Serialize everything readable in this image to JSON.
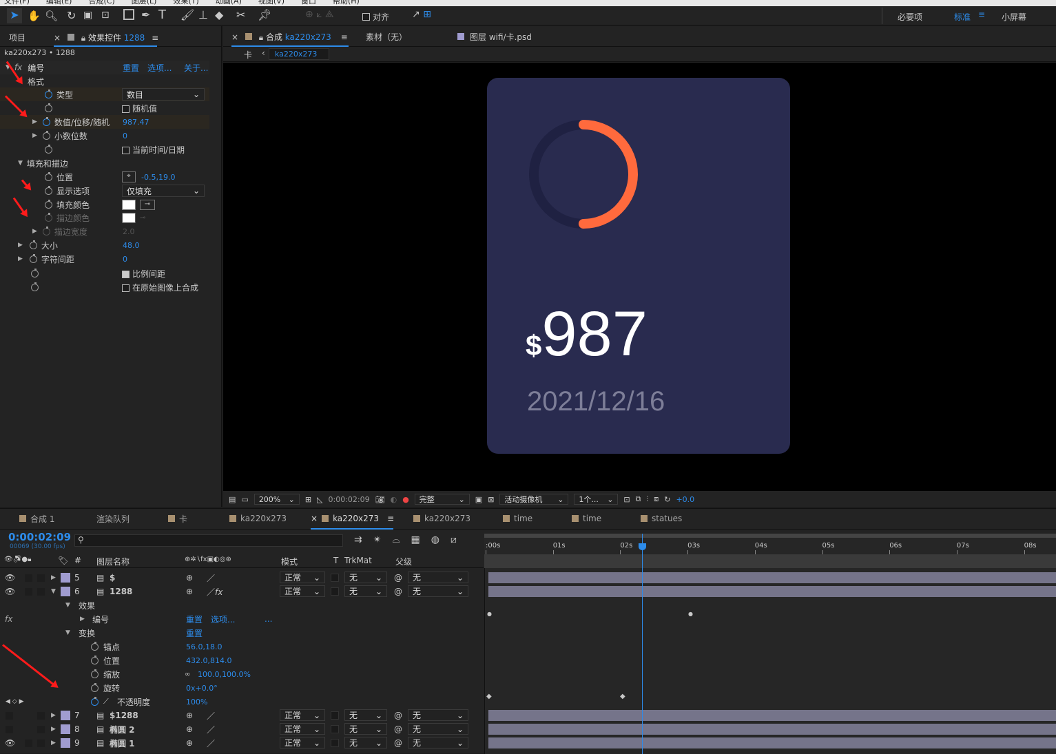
{
  "menu": {
    "items": [
      "文件(F)",
      "编辑(E)",
      "合成(C)",
      "图层(L)",
      "效果(T)",
      "动画(A)",
      "视图(V)",
      "窗口",
      "帮助(H)"
    ]
  },
  "toolbar": {
    "align_label": "对齐",
    "workspaces": [
      "必要项",
      "标准",
      "小屏幕"
    ]
  },
  "left_panel": {
    "tab_project": "项目",
    "tab_effects": "效果控件",
    "tab_effects_layer": "1288",
    "breadcrumb": "ka220x273 • 1288",
    "effect_name": "编号",
    "reset": "重置",
    "options": "选项...",
    "about": "关于...",
    "section_format": "格式",
    "type_label": "类型",
    "type_value": "数目",
    "random_label": "随机值",
    "value_label": "数值/位移/随机",
    "value": "987.47",
    "decimals_label": "小数位数",
    "decimals_value": "0",
    "curtime_label": "当前时间/日期",
    "section_fill": "填充和描边",
    "position_label": "位置",
    "position_value": "-0.5,19.0",
    "display_label": "显示选项",
    "display_value": "仅填充",
    "fillcolor_label": "填充颜色",
    "strokecolor_label": "描边颜色",
    "strokewidth_label": "描边宽度",
    "strokewidth_value": "2.0",
    "size_label": "大小",
    "size_value": "48.0",
    "tracking_label": "字符间距",
    "tracking_value": "0",
    "proportional_label": "比例间距",
    "composite_label": "在原始图像上合成"
  },
  "viewer": {
    "tab_comp_prefix": "合成",
    "tab_comp": "ka220x273",
    "tab_footage": "素材（无）",
    "tab_layer": "图层 wifi/卡.psd",
    "crumb_parent": "卡",
    "crumb_current": "ka220x273",
    "card": {
      "currency": "$",
      "amount": "987",
      "date": "2021/12/16",
      "ring_value": 0.5,
      "bg": "#292b4f",
      "ring_track": "#1f2142",
      "ring_color": "#ff6a3d"
    },
    "zoom": "200%",
    "timecode": "0:00:02:09",
    "quality": "完整",
    "camera": "活动摄像机",
    "views": "1个...",
    "exposure": "+0.0"
  },
  "timeline": {
    "tabs": [
      "合成 1",
      "渲染队列",
      "卡",
      "ka220x273",
      "ka220x273",
      "ka220x273",
      "time",
      "time",
      "statues"
    ],
    "timecode": "0:00:02:09",
    "fps": "00069 (30.00 fps)",
    "col_layername": "图层名称",
    "col_mode": "模式",
    "col_t": "T",
    "col_trkmat": "TrkMat",
    "col_parent": "父级",
    "ruler": [
      ":00s",
      "01s",
      "02s",
      "03s",
      "04s",
      "05s",
      "06s",
      "07s",
      "08s"
    ],
    "mode_normal": "正常",
    "none": "无",
    "layers": [
      {
        "num": "5",
        "name": "$"
      },
      {
        "num": "6",
        "name": "1288"
      },
      {
        "num": "7",
        "name": "$1288"
      },
      {
        "num": "8",
        "name": "椭圆 2"
      },
      {
        "num": "9",
        "name": "椭圆 1"
      }
    ],
    "effects_label": "效果",
    "fx_name": "编号",
    "fx_reset": "重置",
    "fx_options": "选项...",
    "fx_more": "...",
    "transform_label": "变换",
    "transform_reset": "重置",
    "anchor_label": "锚点",
    "anchor_value": "56.0,18.0",
    "pos_label": "位置",
    "pos_value": "432.0,814.0",
    "scale_label": "缩放",
    "scale_value": "100.0,100.0%",
    "rot_label": "旋转",
    "rot_value": "0x+0.0°",
    "opacity_label": "不透明度",
    "opacity_value": "100%"
  }
}
